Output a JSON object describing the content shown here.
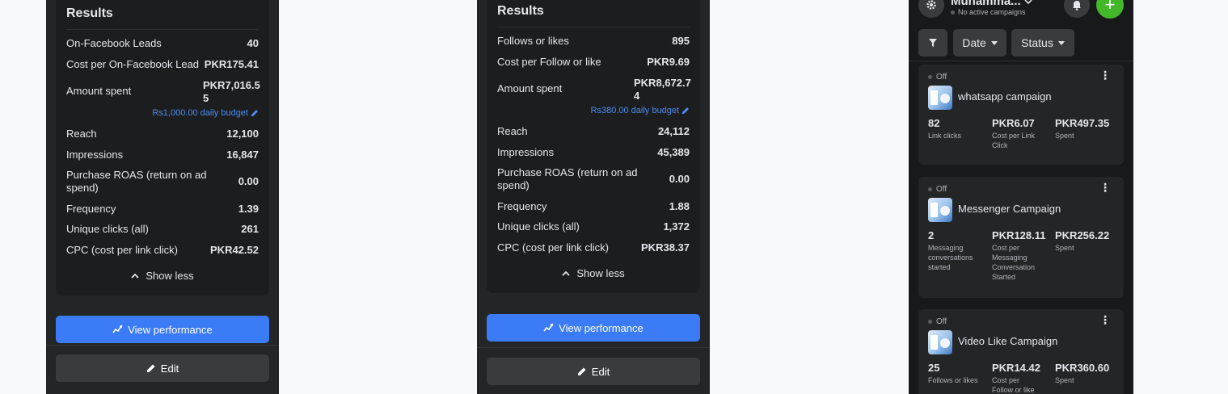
{
  "panel1": {
    "results_title": "Results",
    "metrics": [
      {
        "label": "On-Facebook Leads",
        "value": "40"
      },
      {
        "label": "Cost per On-Facebook Lead",
        "value": "PKR175.41"
      },
      {
        "label": "Amount spent",
        "value": "PKR7,016.5\n5"
      },
      {
        "label": "Reach",
        "value": "12,100"
      },
      {
        "label": "Impressions",
        "value": "16,847"
      },
      {
        "label": "Purchase ROAS (return on ad spend)",
        "value": "0.00"
      },
      {
        "label": "Frequency",
        "value": "1.39"
      },
      {
        "label": "Unique clicks (all)",
        "value": "261"
      },
      {
        "label": "CPC (cost per link click)",
        "value": "PKR42.52"
      }
    ],
    "budget": "Rs1,000.00 daily budget",
    "show_less": "Show less",
    "view_performance": "View performance",
    "edit": "Edit"
  },
  "panel2": {
    "results_title": "Results",
    "metrics": [
      {
        "label": "Follows or likes",
        "value": "895"
      },
      {
        "label": "Cost per Follow or like",
        "value": "PKR9.69"
      },
      {
        "label": "Amount spent",
        "value": "PKR8,672.7\n4"
      },
      {
        "label": "Reach",
        "value": "24,112"
      },
      {
        "label": "Impressions",
        "value": "45,389"
      },
      {
        "label": "Purchase ROAS (return on ad spend)",
        "value": "0.00"
      },
      {
        "label": "Frequency",
        "value": "1.88"
      },
      {
        "label": "Unique clicks (all)",
        "value": "1,372"
      },
      {
        "label": "CPC (cost per link click)",
        "value": "PKR38.37"
      }
    ],
    "budget": "Rs380.00 daily budget",
    "show_less": "Show less",
    "view_performance": "View performance",
    "edit": "Edit"
  },
  "panel3": {
    "account_name": "Muhamma...",
    "account_status": "No active campaigns",
    "filters": {
      "date": "Date",
      "status": "Status"
    },
    "campaigns": [
      {
        "status": "Off",
        "name": "whatsapp campaign",
        "stats": [
          {
            "value": "82",
            "label": "Link clicks"
          },
          {
            "value": "PKR6.07",
            "label": "Cost per Link Click"
          },
          {
            "value": "PKR497.35",
            "label": "Spent"
          }
        ]
      },
      {
        "status": "Off",
        "name": "Messenger Campaign",
        "stats": [
          {
            "value": "2",
            "label": "Messaging conversations started"
          },
          {
            "value": "PKR128.11",
            "label": "Cost per Messaging Conversation Started"
          },
          {
            "value": "PKR256.22",
            "label": "Spent"
          }
        ]
      },
      {
        "status": "Off",
        "name": "Video Like Campaign",
        "stats": [
          {
            "value": "25",
            "label": "Follows or likes"
          },
          {
            "value": "PKR14.42",
            "label": "Cost per Follow or like"
          },
          {
            "value": "PKR360.60",
            "label": "Spent"
          }
        ]
      }
    ]
  }
}
